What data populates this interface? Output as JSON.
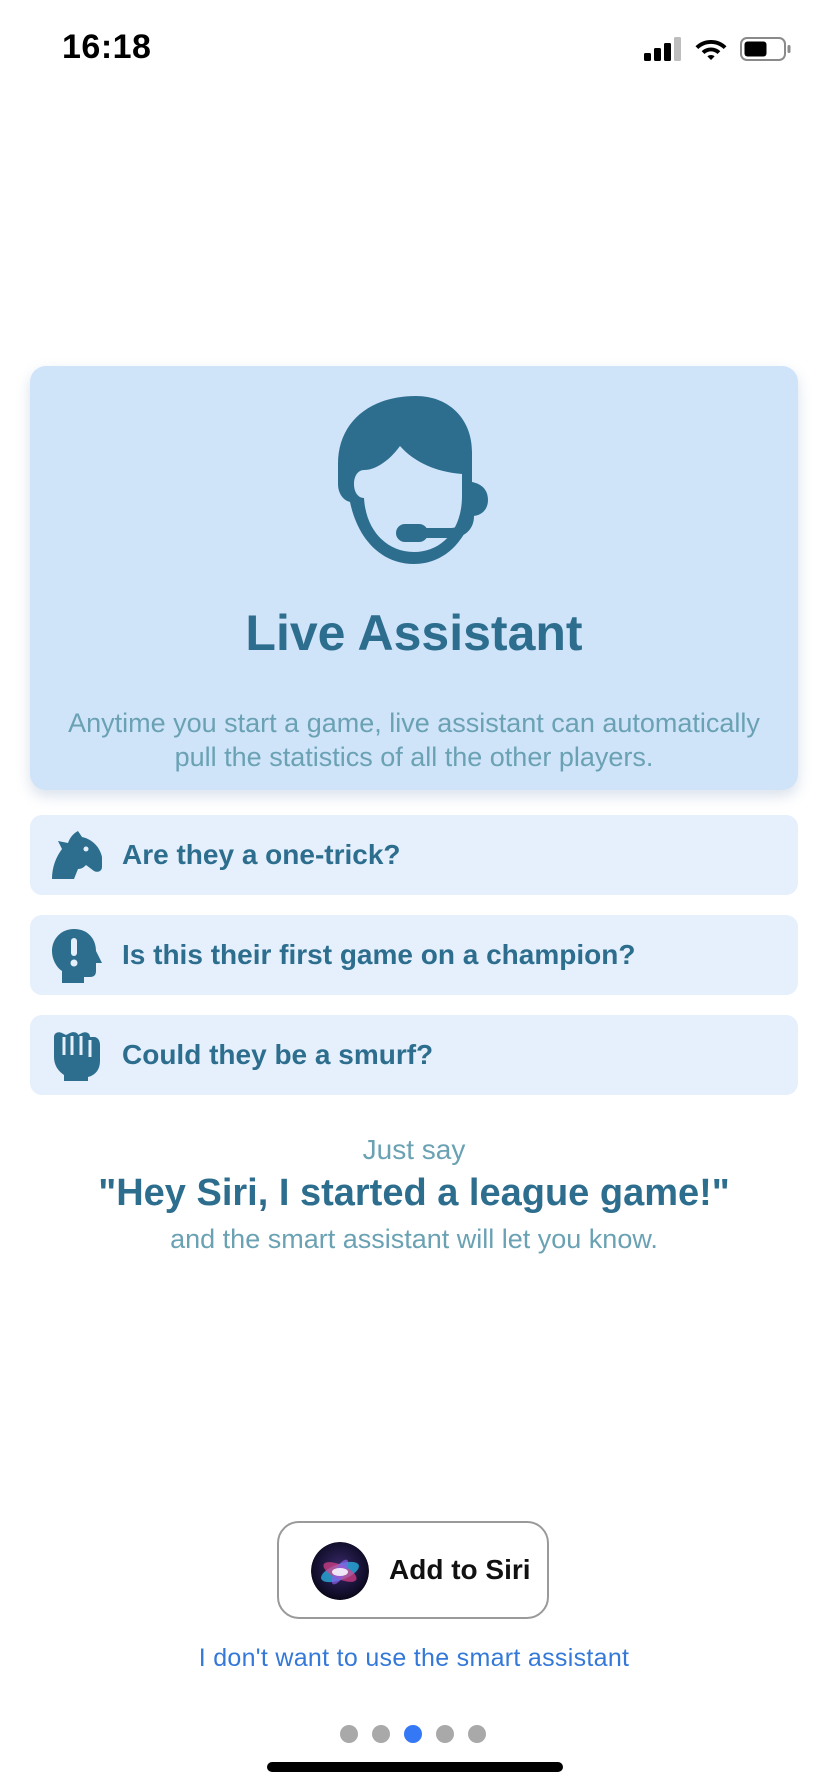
{
  "status_bar": {
    "time": "16:18",
    "signal_icon": "cellular-signal-icon",
    "wifi_icon": "wifi-icon",
    "battery_icon": "battery-icon"
  },
  "hero": {
    "icon": "headset-operator-icon",
    "title": "Live Assistant",
    "description": "Anytime you start a game, live assistant can automatically pull the statistics of all the other players."
  },
  "features": [
    {
      "icon": "horse-head-icon",
      "label": "Are they a one-trick?"
    },
    {
      "icon": "head-exclamation-icon",
      "label": "Is this their first game on a champion?"
    },
    {
      "icon": "fist-icon",
      "label": "Could they be a smurf?"
    }
  ],
  "prompt": {
    "intro": "Just say",
    "phrase": "\"Hey Siri, I started a league game!\"",
    "outro": "and the smart assistant will let you know."
  },
  "siri_button": {
    "icon": "siri-icon",
    "label": "Add to Siri"
  },
  "decline_link": "I don't want to use the smart assistant",
  "pagination": {
    "total_pages": 5,
    "current_page": 3
  },
  "colors": {
    "accent": "#2d6e8e",
    "muted_text": "#6aa2b4",
    "card_bg": "#cfe3f9",
    "feature_bg": "#e5f0fc",
    "link": "#3478d8",
    "active_dot": "#3478f6"
  }
}
